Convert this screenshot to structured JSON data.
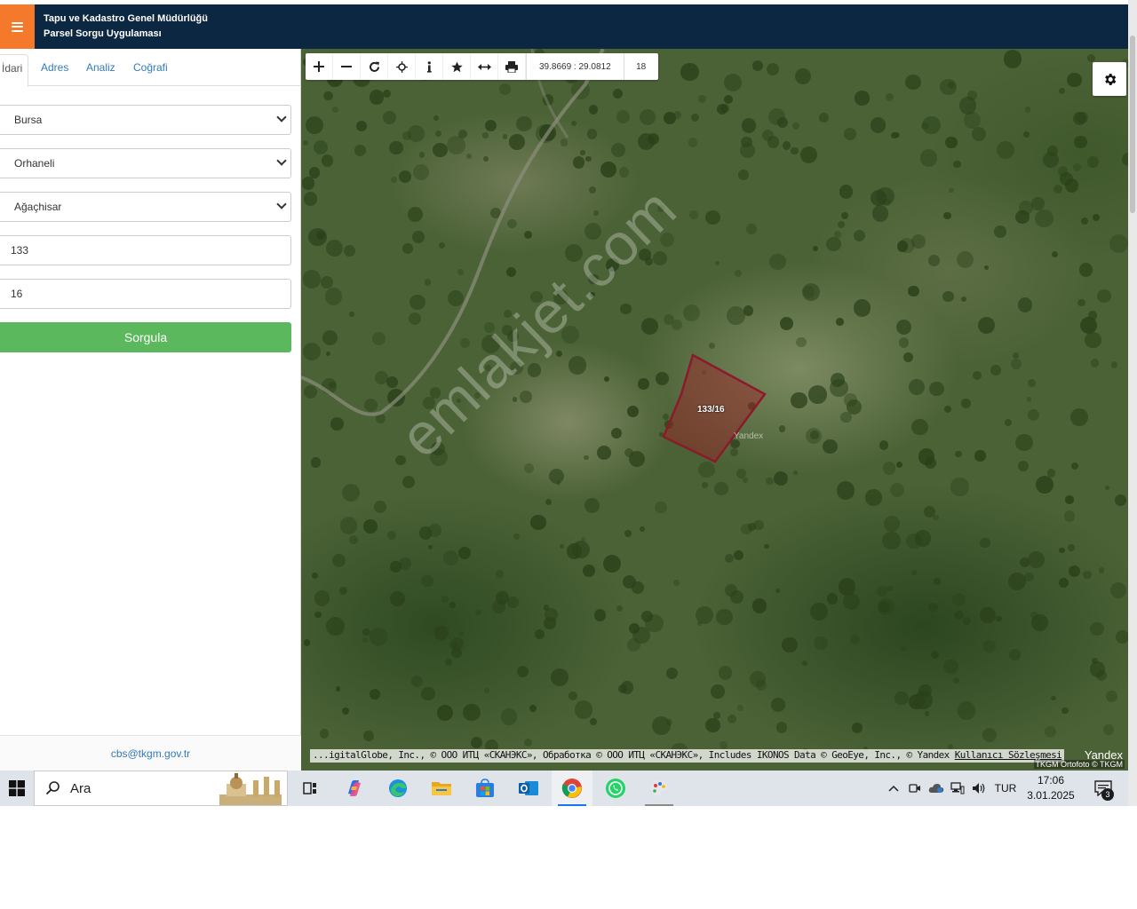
{
  "header": {
    "title_line1": "Tapu ve Kadastro Genel Müdürlüğü",
    "title_line2": "Parsel Sorgu Uygulaması"
  },
  "tabs": [
    {
      "label": "İdari",
      "active": true
    },
    {
      "label": "Adres",
      "active": false
    },
    {
      "label": "Analiz",
      "active": false
    },
    {
      "label": "Coğrafi",
      "active": false
    }
  ],
  "form": {
    "il": "Bursa",
    "ilce": "Orhaneli",
    "mahalle": "Ağaçhisar",
    "ada": "133",
    "parsel": "16",
    "submit_label": "Sorgula"
  },
  "footer": {
    "email": "cbs@tkgm.gov.tr"
  },
  "map": {
    "toolbar_icons": [
      "plus-icon",
      "minus-icon",
      "refresh-icon",
      "crosshair-icon",
      "info-icon",
      "star-icon",
      "measure-icon",
      "print-icon"
    ],
    "coordinates": "39.8669 : 29.0812",
    "zoom_level": "18",
    "watermark": "emlakjet.com",
    "parcel_label": "133/16",
    "parcel_color": "#8b1a2b",
    "yandex_mark": "Yandex",
    "attribution_text": "...igitalGlobe, Inc., © ООО ИТЦ «СКАНЭКС», Обработка © ООО ИТЦ «СКАНЭКС», Includes IKONOS Data © GeoEye, Inc., © Yandex ",
    "attribution_link": "Kullanıcı Sözleşmesi",
    "yandex_logo": "Yandex",
    "orthophoto_credit": "TKGM Ortofoto © TKGM"
  },
  "taskbar": {
    "search_label": "Ara",
    "apps": [
      "task-view-icon",
      "copilot-icon",
      "edge-icon",
      "file-explorer-icon",
      "store-icon",
      "outlook-icon",
      "chrome-icon",
      "whatsapp-icon",
      "paint-icon"
    ],
    "language": "TUR",
    "time": "17:06",
    "date": "3.01.2025",
    "notification_count": "3"
  },
  "colors": {
    "header_bg": "#0c2742",
    "menu_accent": "#f5792a",
    "submit_bg": "#5cb85c",
    "link": "#337ab7"
  }
}
